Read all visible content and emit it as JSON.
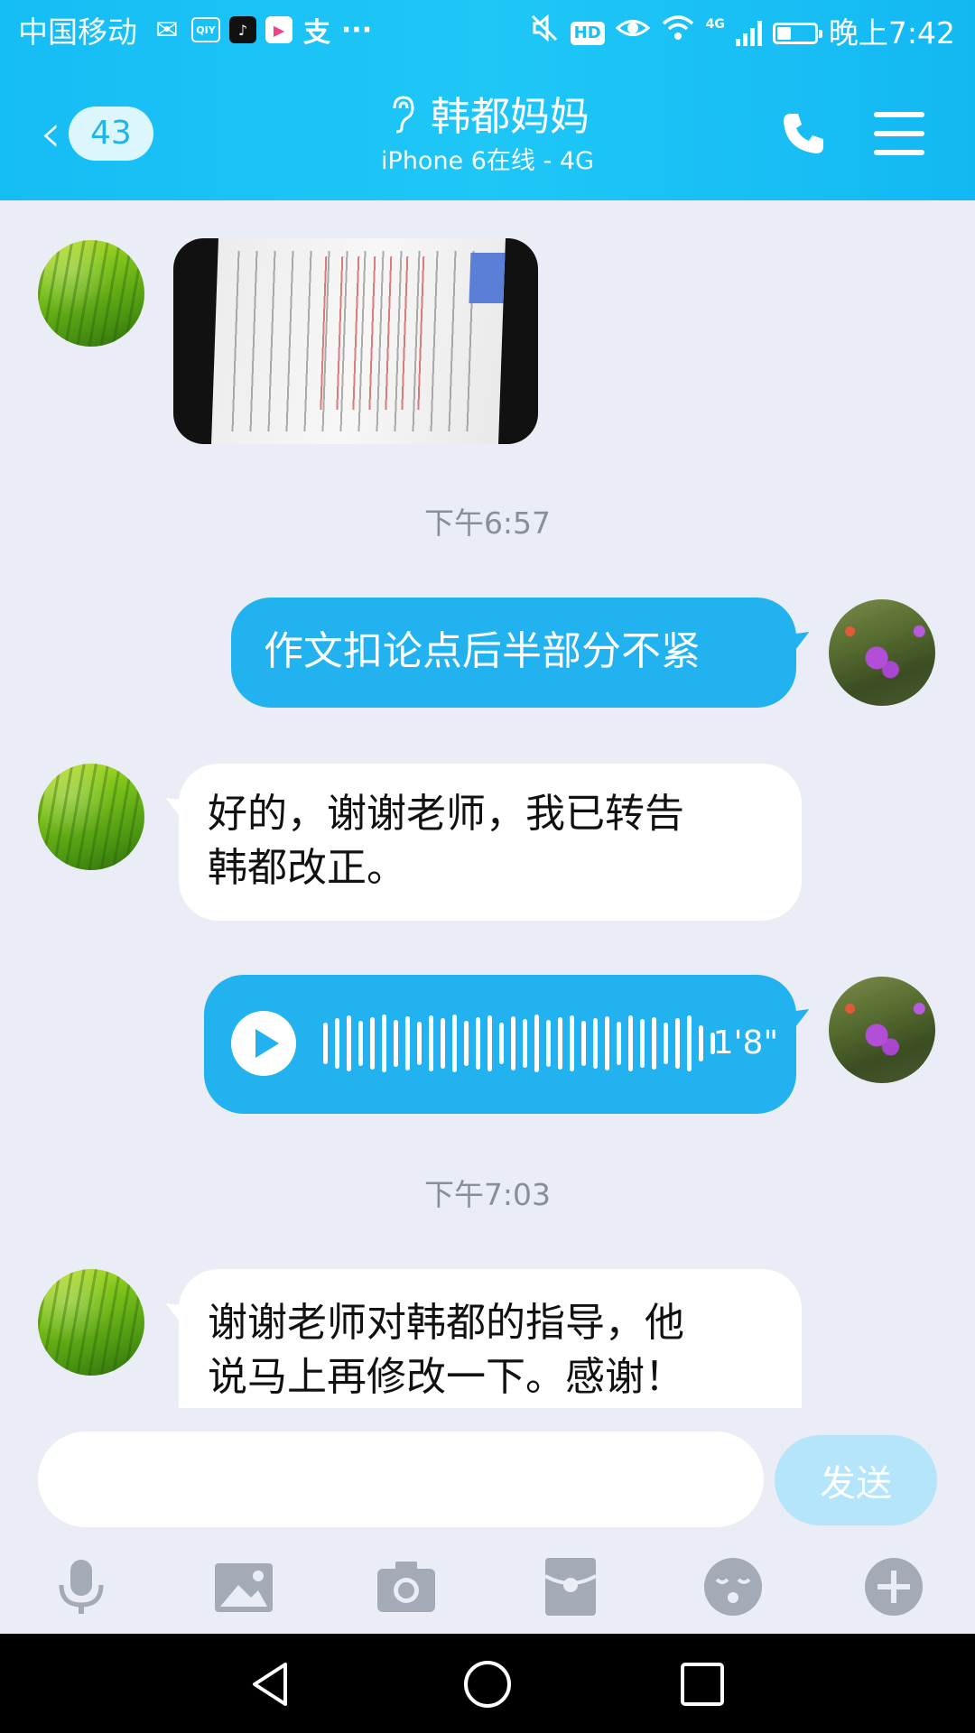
{
  "status_bar": {
    "carrier": "中国移动",
    "apps": [
      "wechat-icon",
      "iqiyi-icon",
      "tiktok-icon",
      "video-app-icon",
      "alipay-icon",
      "more-icon"
    ],
    "iqiyi_text": "QIY",
    "more": "···",
    "hd": "HD",
    "network": "4G",
    "time": "晚上7:42",
    "battery_level": 0.35
  },
  "header": {
    "back_count": "43",
    "title": "韩都妈妈",
    "subtitle": "iPhone 6在线 - 4G",
    "ear_icon": "👂"
  },
  "messages": [
    {
      "type": "image",
      "from": "contact",
      "content": "photo of handwritten essay"
    },
    {
      "type": "time",
      "text": "下午6:57"
    },
    {
      "type": "text",
      "from": "me",
      "text": "作文扣论点后半部分不紧"
    },
    {
      "type": "text",
      "from": "contact",
      "text_line1": "好的，谢谢老师，我已转告",
      "text_line2": "韩都改正。"
    },
    {
      "type": "voice",
      "from": "me",
      "duration": "1'8\""
    },
    {
      "type": "time",
      "text": "下午7:03"
    },
    {
      "type": "text",
      "from": "contact",
      "text_line1": "谢谢老师对韩都的指导，他",
      "text_line2": "说马上再修改一下。感谢！"
    }
  ],
  "input": {
    "value": "",
    "placeholder": "",
    "send_label": "发送"
  },
  "toolbar": [
    "microphone-icon",
    "image-icon",
    "camera-icon",
    "red-packet-icon",
    "emoji-icon",
    "plus-icon"
  ],
  "colors": {
    "header": "#1fc7f7",
    "bubble_out": "#22b2f0",
    "bubble_in": "#ffffff",
    "background": "#eaedf5",
    "send_disabled": "#b5e5fb"
  }
}
